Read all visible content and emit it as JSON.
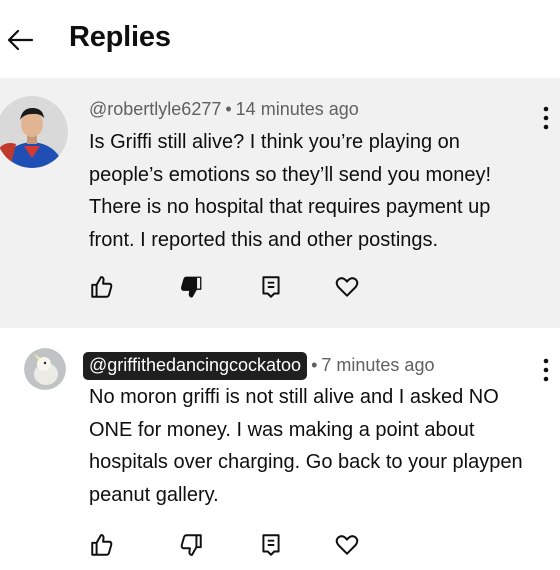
{
  "header": {
    "title": "Replies"
  },
  "comments": [
    {
      "handle": "@robertlyle6277",
      "time": "14 minutes ago",
      "text": "Is Griffi still alive? I think you’re playing on people’s emotions so they’ll send you money! There is no hospital that requires payment up front. I reported this and other postings.",
      "disliked": true
    },
    {
      "handle": "@griffithedancingcockatoo",
      "time": "7 minutes ago",
      "text": "No moron griffi is not still alive and I asked NO ONE for money.  I was making a point about hospitals over charging.  Go back to your playpen peanut gallery.",
      "creator_highlight": true,
      "disliked": false
    }
  ],
  "icons": {
    "back": "arrow-left-icon",
    "like": "thumbs-up-icon",
    "dislike": "thumbs-down-icon",
    "reply": "reply-icon",
    "heart": "heart-icon",
    "more": "more-vertical-icon"
  },
  "colors": {
    "comment_bg": "#f1f1f1",
    "meta": "#606060",
    "chip_bg": "#1f1f1f"
  }
}
